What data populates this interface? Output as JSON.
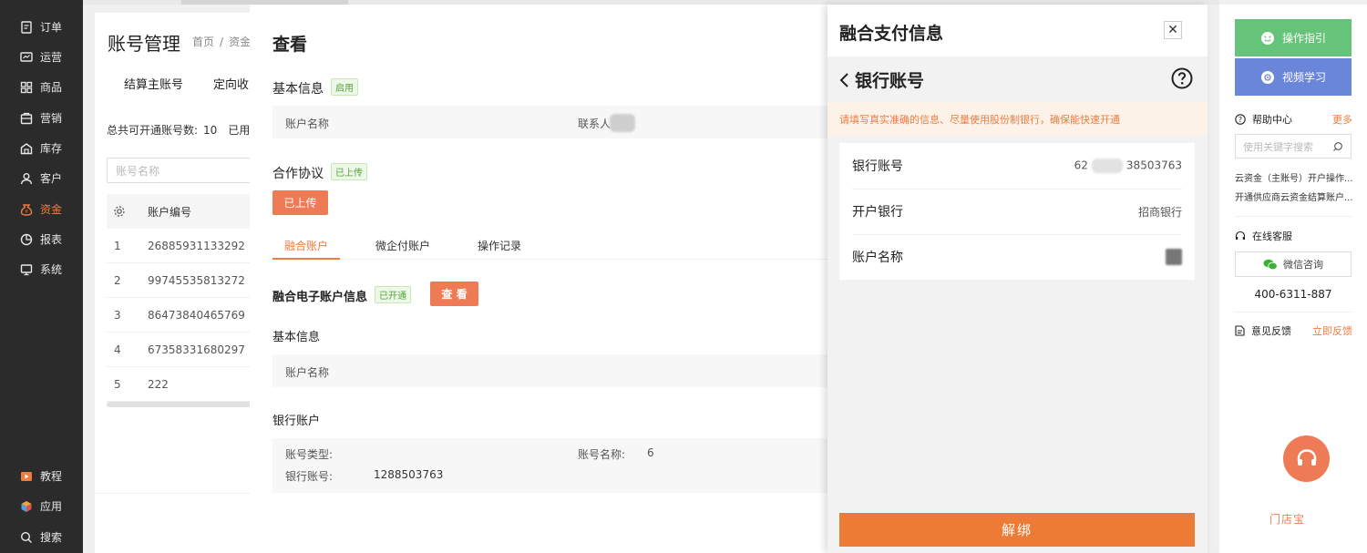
{
  "nav": {
    "items": [
      {
        "label": "订单",
        "icon": "order-icon"
      },
      {
        "label": "运营",
        "icon": "operation-icon"
      },
      {
        "label": "商品",
        "icon": "goods-icon"
      },
      {
        "label": "营销",
        "icon": "marketing-icon"
      },
      {
        "label": "库存",
        "icon": "inventory-icon"
      },
      {
        "label": "客户",
        "icon": "customer-icon"
      },
      {
        "label": "资金",
        "icon": "funds-icon",
        "active": true
      },
      {
        "label": "报表",
        "icon": "report-icon"
      },
      {
        "label": "系统",
        "icon": "system-icon"
      }
    ],
    "bottom": [
      {
        "label": "教程",
        "icon": "tutorial-icon"
      },
      {
        "label": "应用",
        "icon": "apps-icon"
      },
      {
        "label": "搜索",
        "icon": "search-icon"
      }
    ]
  },
  "background_page": {
    "title": "账号管理",
    "breadcrumb": [
      "首页",
      "资金"
    ],
    "tabs": [
      "结算主账号",
      "定向收"
    ],
    "count_label": "总共可开通账号数:",
    "count_value": "10",
    "used_label": "已用",
    "search_placeholder": "账号名称",
    "table_header": "账户编号",
    "rows": [
      {
        "no": "1",
        "id": "26885931133292"
      },
      {
        "no": "2",
        "id": "99745535813272"
      },
      {
        "no": "3",
        "id": "86473840465769"
      },
      {
        "no": "4",
        "id": "67358331680297"
      },
      {
        "no": "5",
        "id": "222"
      }
    ]
  },
  "modal": {
    "title": "查看",
    "basic_info": {
      "title": "基本信息",
      "badge": "启用",
      "account_name_label": "账户名称",
      "contact_label": "联系人"
    },
    "agreement": {
      "title": "合作协议",
      "badge": "已上传",
      "button": "已上传"
    },
    "tabs": [
      "融合账户",
      "微企付账户",
      "操作记录"
    ],
    "fusion": {
      "title": "融合电子账户信息",
      "badge": "已开通",
      "view_button": "查 看"
    },
    "basic_info2": {
      "title": "基本信息",
      "account_name_label": "账户名称"
    },
    "bank": {
      "title": "银行账户",
      "type_label": "账号类型:",
      "name_label": "账号名称:",
      "name_value": "6",
      "number_label": "银行账号:",
      "number_value": "1288503763"
    }
  },
  "drawer": {
    "title": "融合支付信息",
    "close": "✕",
    "subtitle": "银行账号",
    "notice": "请填写真实准确的信息、尽量使用股份制银行，确保能快速开通",
    "rows": [
      {
        "label": "银行账号",
        "value_prefix": "62",
        "value_suffix": "38503763"
      },
      {
        "label": "开户银行",
        "value": "招商银行"
      },
      {
        "label": "账户名称",
        "value": ""
      }
    ],
    "unbind": "解绑"
  },
  "help": {
    "guide_button": "操作指引",
    "video_button": "视频学习",
    "help_center": "帮助中心",
    "more": "更多",
    "search_placeholder": "使用关键字搜索",
    "links": [
      "云资金（主账号）开户操作...",
      "开通供应商云资金结算账户..."
    ],
    "online_service": "在线客服",
    "wechat": "微信咨询",
    "phone": "400-6311-887",
    "feedback": "意见反馈",
    "feedback_link": "立即反馈",
    "logo_text": "门店宝",
    "colors": {
      "guide": "#66c37a",
      "video": "#6a86d8",
      "accent": "#f07c3f"
    }
  }
}
